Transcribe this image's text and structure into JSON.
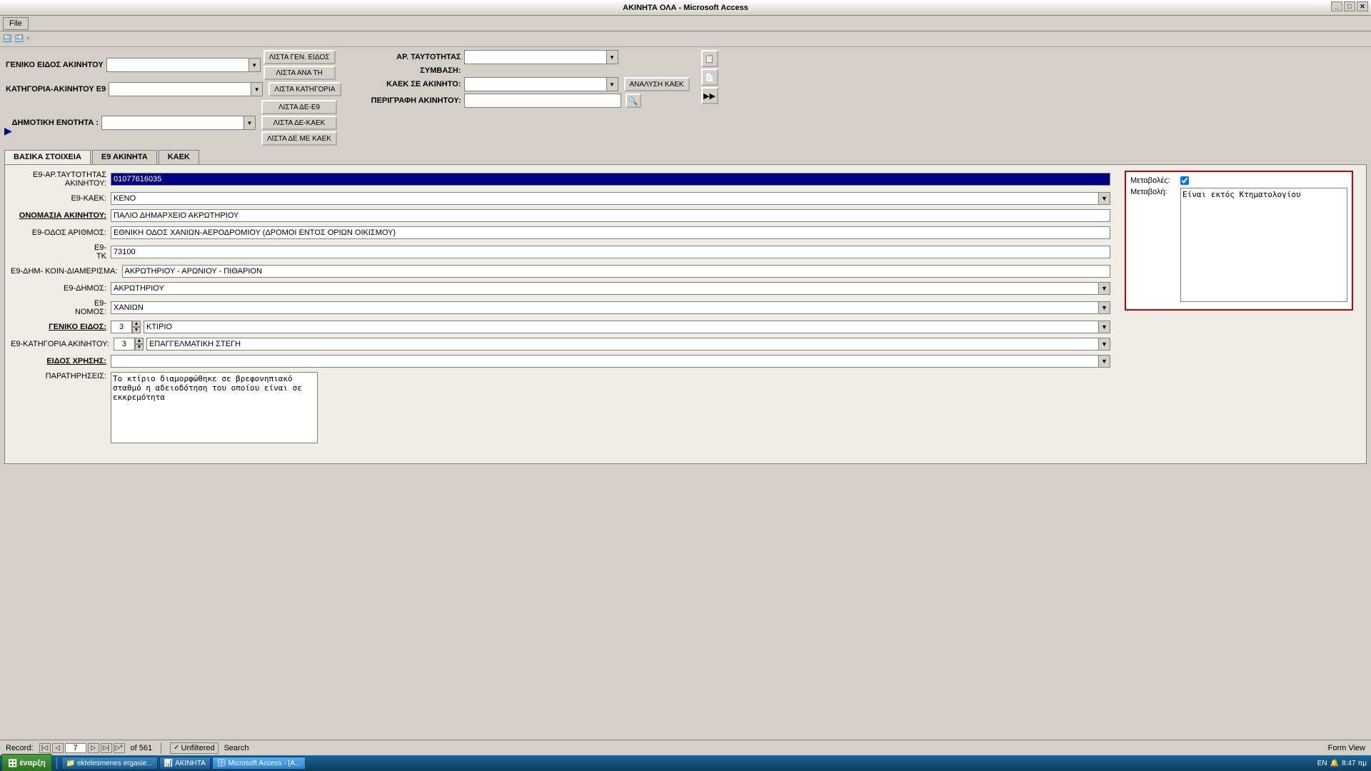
{
  "window": {
    "title": "ΑΚΙΝΗΤΑ ΟΛΑ  -  Microsoft Access",
    "title_bar_btns": [
      "_",
      "□",
      "✕"
    ]
  },
  "menu": {
    "file_label": "File"
  },
  "quick_access": {
    "btns": [
      "◁",
      "▷"
    ]
  },
  "filter_section": {
    "geniko_label": "ΓΕΝΙΚΟ ΕΙΔΟΣ ΑΚΙΝΗΤΟΥ",
    "btn_lista_gen": "ΛΙΣΤΑ ΓΕΝ. ΕΙΔΟΣ",
    "btn_lista_ana_ti": "ΛΙΣΤΑ ΑΝΑ ΤΗ",
    "katigoria_label": "ΚΑΤΗΓΟΡΙΑ-ΑΚΙΝΗΤΟΥ Ε9",
    "btn_lista_katigoria": "ΛΙΣΤΑ ΚΑΤΗΓΟΡΙΑ",
    "dhmotiki_label": "ΔΗΜΟΤΙΚΗ ΕΝΟΤΗΤΑ :",
    "btn_lista_de_e9": "ΛΙΣΤΑ ΔΕ-Ε9",
    "btn_lista_de_kaek": "ΛΙΣΤΑ ΔΕ-ΚΑΕΚ",
    "btn_lista_de_me_kaek": "ΛΙΣΤΑ ΔΕ ΜΕ ΚΑΕΚ",
    "ar_taytotitas_label": "ΑΡ. ΤΑΥΤΟΤΗΤΑΣ",
    "symvasi_label": "ΣΥΜΒΑΣΗ:",
    "kaek_se_akinito_label": "ΚΑΕΚ ΣΕ ΑΚΙΝΗΤΟ:",
    "btn_analysi_kaek": "ΑΝΑΛΥΣΗ ΚΑΕΚ",
    "perigrafi_label": "ΠΕΡΙΓΡΑΦΗ ΑΚΙΝΗΤΟΥ:"
  },
  "tabs": {
    "tab1": "ΒΑΣΙΚΑ ΣΤΟΙΧΕΙΑ",
    "tab2": "Ε9 ΑΚΙΝΗΤΑ",
    "tab3": "ΚΑΕΚ"
  },
  "form": {
    "e9_ar_taytotitas_label": "Ε9-ΑΡ.ΤΑΥΤΟΤΗΤΑΣ",
    "e9_ar_taytotitas_label2": "ΑΚΙΝΗΤΟΥ:",
    "e9_ar_taytotitas_value": "01077616035",
    "e9_kaek_label": "Ε9-ΚΑΕΚ:",
    "e9_kaek_value": "ΚΕΝΟ",
    "onomasia_label": "ΟΝΟΜΑΣΙΑ ΑΚΙΝΗΤΟΥ:",
    "onomasia_value": "ΠΑΛΙΟ ΔΗΜΑΡΧΕΙΟ ΑΚΡΩΤΗΡΙΟΥ",
    "e9_odos_label": "Ε9-ΟΔΟΣ ΑΡΙΘΜΟΣ:",
    "e9_odos_value": "ΕΘΝΙΚΗ ΟΔΟΣ ΧΑΝΙΩΝ-ΑΕΡΟΔΡΟΜΙΟΥ (ΔΡΟΜΟΙ ΕΝΤΟΣ ΟΡΙΩΝ ΟΙΚΙΣΜΟΥ)",
    "e9_tk_label": "Ε9-",
    "e9_tk_label2": "ΤΚ",
    "e9_tk_value": "73100",
    "e9_dhm_koin_label": "Ε9-ΔΗΜ- ΚΟΙΝ-ΔΙΑΜΕΡΙΣΜΑ:",
    "e9_dhm_koin_value": "ΑΚΡΩΤΗΡΙΟΥ - ΑΡΩΝΙΟΥ - ΠΙΘΑΡΙΟΝ",
    "e9_dhmos_label": "Ε9-ΔΗΜΟΣ:",
    "e9_dhmos_value": "ΑΚΡΩΤΗΡΙΟΥ",
    "e9_nomos_label": "Ε9-",
    "e9_nomos_label2": "ΝΟΜΟΣ:",
    "e9_nomos_value": "ΧΑΝΙΩΝ",
    "geniko_eidos_label": "ΓΕΝΙΚΟ ΕΙΔΟΣ:",
    "geniko_eidos_num": "3",
    "geniko_eidos_value": "ΚΤΙΡΙΟ",
    "e9_katigoria_label": "Ε9-ΚΑΤΗΓΟΡΙΑ  ΑΚΙΝΗΤΟΥ:",
    "e9_katigoria_num": "3",
    "e9_katigoria_value": "ΕΠΑΓΓΕΛΜΑΤΙΚΗ ΣΤΕΓΗ",
    "eidos_xrisis_label": "ΕΙΔΟΣ ΧΡΗΣΗΣ:",
    "eidos_xrisis_value": "",
    "paratirisis_label": "ΠΑΡΑΤΗΡΗΣΕΙΣ:",
    "paratirisis_value": "Το κτίριο διαμορφώθηκε σε βρεφονηπιακό σταθμό η αδειοδότηση του οποίου είναι σε εκκρεμότητα",
    "metavoli_label": "Μεταβολές:",
    "metavoli_checkbox": true,
    "metavoli_text_label": "Μεταβολή:",
    "metavoli_text_value": "Είναι εκτός Κτηματολογίου"
  },
  "status_bar": {
    "record_label": "Record:",
    "first_btn": "|◁",
    "prev_btn": "◁",
    "next_btn": "▷",
    "last_btn": "▷|",
    "new_btn": "▷*",
    "current": "7",
    "total": "561",
    "unfiltered_label": "Unfiltered",
    "search_label": "Search",
    "form_view_label": "Form View"
  },
  "taskbar": {
    "start_label": "έναρξη",
    "app1": "ektelesmenes ergasie...",
    "app2": "ΑΚΙΝΗΤΑ",
    "app3": "Microsoft Access - [A...",
    "time": "8:47 πμ",
    "lang": "EN"
  }
}
